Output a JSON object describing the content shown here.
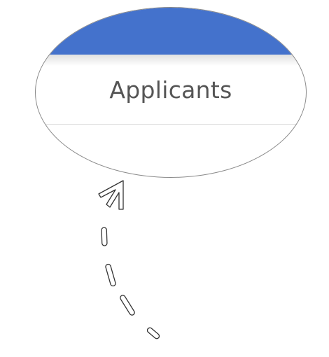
{
  "magnifier": {
    "title": "Applicants",
    "header_color": "#4472cc",
    "title_color": "#555555"
  },
  "pointer": {
    "icon": "dashed-curved-arrow-icon"
  }
}
